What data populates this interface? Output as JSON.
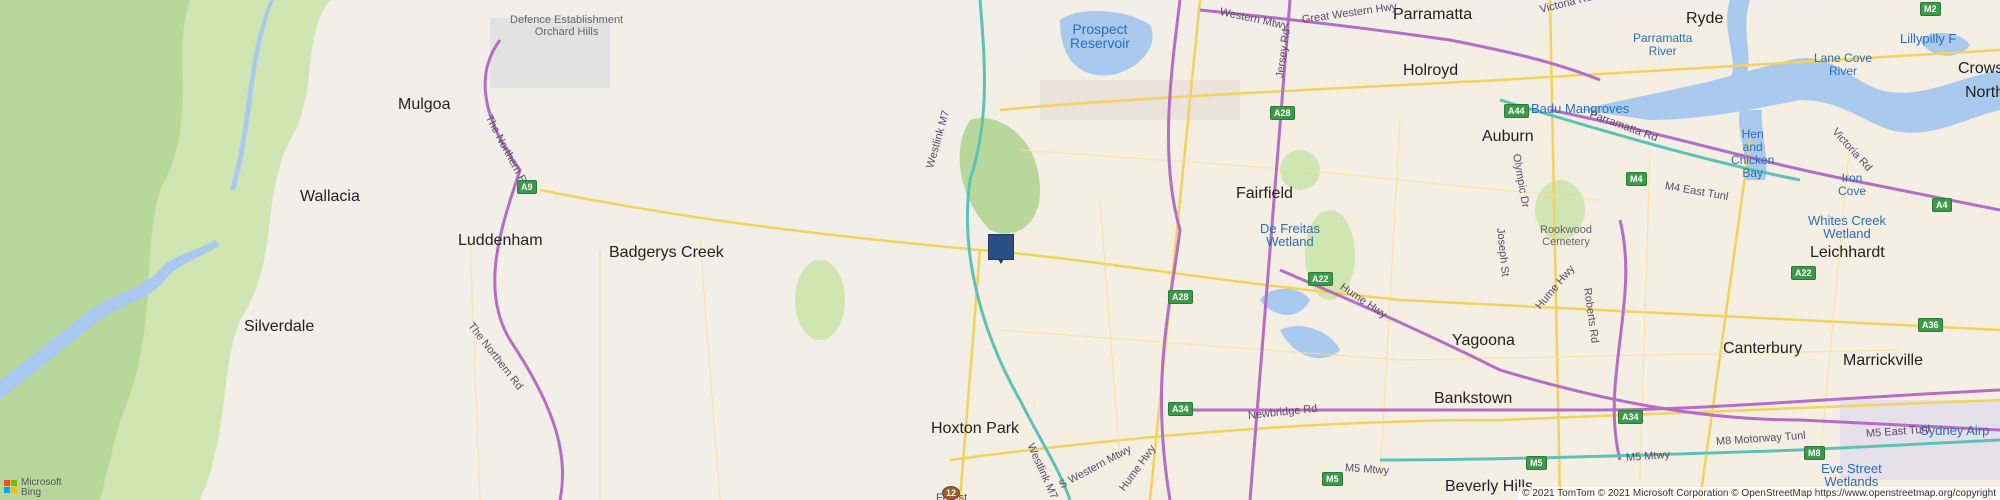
{
  "map": {
    "places": {
      "orchard_hills_1": "Defence Establishment",
      "orchard_hills_2": "Orchard Hills",
      "prospect_1": "Prospect",
      "prospect_2": "Reservoir",
      "parramatta": "Parramatta",
      "ryde": "Ryde",
      "parramatta_river_1": "Parramatta",
      "parramatta_river_2": "River",
      "lilly": "Lillypilly F",
      "crows": "Crows",
      "north": "North",
      "mulgoa": "Mulgoa",
      "holroyd": "Holroyd",
      "badu": "Badu Mangroves",
      "auburn": "Auburn",
      "lane_cove_1": "Lane Cove",
      "lane_cove_2": "River",
      "hen_1": "Hen",
      "hen_2": "and",
      "hen_3": "Chicken",
      "hen_4": "Bay",
      "iron_1": "Iron",
      "iron_2": "Cove",
      "wallacia": "Wallacia",
      "fairfield": "Fairfield",
      "rookwood_1": "Rookwood",
      "rookwood_2": "Cemetery",
      "whites_1": "Whites Creek",
      "whites_2": "Wetland",
      "leichhardt": "Leichhardt",
      "luddenham": "Luddenham",
      "defreitas_1": "De Freitas",
      "defreitas_2": "Wetland",
      "badgerys": "Badgerys Creek",
      "silverdale": "Silverdale",
      "yagoona": "Yagoona",
      "canterbury": "Canterbury",
      "marrickville": "Marrickville",
      "bankstown": "Bankstown",
      "hoxton": "Hoxton Park",
      "eve_1": "Eve Street",
      "eve_2": "Wetlands",
      "beverly": "Beverly Hills",
      "sydney_airport": "Sydney Airp"
    },
    "roads": {
      "western_mtwy": "Western Mtwy",
      "great_western": "Great Western Hwy",
      "victoria_rd_top": "Victoria Rd",
      "northern_rd_1": "The Northern Rd",
      "northern_rd_2": "The Northern Rd",
      "westlink_1": "Westlink M7",
      "westlink_2": "Westlink M7",
      "jersey": "Jersey Rd",
      "parramatta_rd": "Parramatta Rd",
      "olympic": "Olympic Dr",
      "joseph": "Joseph St",
      "victoria_rd": "Victoria Rd",
      "m4_east": "M4 East Tunl",
      "hume_1": "Hume Hwy",
      "hume_2": "Hume Hwy",
      "roberts": "Roberts Rd",
      "newbridge": "Newbridge Rd",
      "m5_mtwy": "M5 Mtwy",
      "m8_tunl": "M8 Motorway Tunl",
      "m5_east": "M5 East Tunl",
      "s_western": "S Western Mtwy",
      "hume_3": "Hume Hwy",
      "fourth": "Forest"
    },
    "shields": {
      "a9": "A9",
      "a28_1": "A28",
      "a28_2": "A28",
      "a44": "A44",
      "m4": "M4",
      "a4": "A4",
      "a22_1": "A22",
      "a22_2": "A22",
      "a36": "A36",
      "a34_1": "A34",
      "a34_2": "A34",
      "m5_1": "M5",
      "m5_2": "M5",
      "m8": "M8",
      "m2": "M2",
      "r12": "12"
    },
    "marker_label": "Location marker"
  },
  "branding": {
    "logo_line1": "Microsoft",
    "logo_line2": "Bing"
  },
  "attribution": "© 2021 TomTom © 2021 Microsoft Corporation © OpenStreetMap https://www.openstreetmap.org/copyright",
  "colors": {
    "land": "#f2efe9",
    "park": "#cfe5b2",
    "forest": "#b7d89a",
    "water": "#a9c9ee",
    "urban": "#ece3dc",
    "highway": "#b66dc5",
    "majorroad": "#f2d35c",
    "motorway": "#5cc2b8",
    "marker": "#2a4f86"
  }
}
